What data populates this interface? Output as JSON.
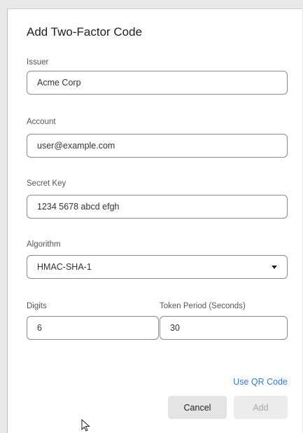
{
  "dialog": {
    "title": "Add Two-Factor Code",
    "issuer": {
      "label": "Issuer",
      "value": "Acme Corp"
    },
    "account": {
      "label": "Account",
      "value": "user@example.com"
    },
    "secret": {
      "label": "Secret Key",
      "value": "1234 5678 abcd efgh"
    },
    "algorithm": {
      "label": "Algorithm",
      "value": "HMAC-SHA-1"
    },
    "digits": {
      "label": "Digits",
      "value": "6"
    },
    "period": {
      "label": "Token Period (Seconds)",
      "value": "30"
    },
    "qr_link": "Use QR Code",
    "cancel_label": "Cancel",
    "add_label": "Add"
  },
  "colors": {
    "accent": "#2f7ad6",
    "border": "#8a8a8a"
  }
}
